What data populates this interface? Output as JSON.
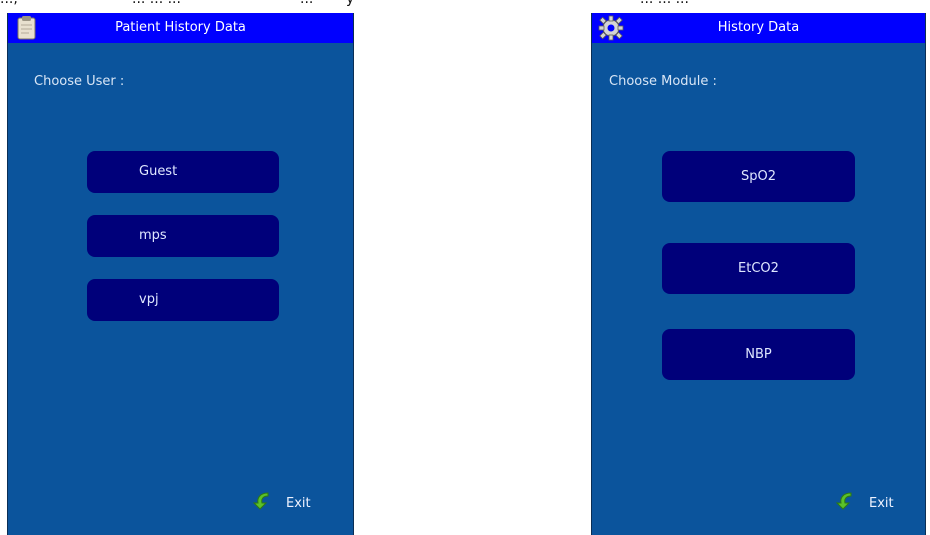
{
  "top_partial": [
    {
      "text": "...,"
    },
    {
      "text": "... ... ..."
    },
    {
      "text": "..."
    },
    {
      "text": "y"
    },
    {
      "text": "... ... ..."
    }
  ],
  "left_panel": {
    "title": "Patient History Data",
    "title_icon": "clipboard-icon",
    "prompt": "Choose User :",
    "options": [
      {
        "label": "Guest"
      },
      {
        "label": "mps"
      },
      {
        "label": "vpj"
      }
    ],
    "exit_label": "Exit",
    "exit_icon": "green-back-arrow-icon"
  },
  "right_panel": {
    "title": "History Data",
    "title_icon": "gear-icon",
    "prompt": "Choose Module :",
    "options": [
      {
        "label": "SpO2"
      },
      {
        "label": "EtCO2"
      },
      {
        "label": "NBP"
      }
    ],
    "exit_label": "Exit",
    "exit_icon": "green-back-arrow-icon"
  },
  "colors": {
    "panel_bg": "#0b549c",
    "title_bar": "#0000ff",
    "button_bg": "#00007a",
    "text": "#dfe7ff"
  }
}
